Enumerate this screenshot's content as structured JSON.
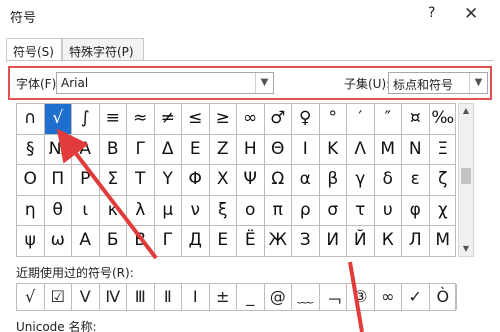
{
  "dialog": {
    "title": "符号",
    "help": "?",
    "close": "✕"
  },
  "tabs": [
    {
      "label": "符号(S)"
    },
    {
      "label": "特殊字符(P)"
    }
  ],
  "font": {
    "label": "字体(F):",
    "value": "Arial"
  },
  "subset": {
    "label": "子集(U):",
    "value": "标点和符号"
  },
  "symbols": [
    [
      "∩",
      "√",
      "∫",
      "≡",
      "≈",
      "≠",
      "≤",
      "≥",
      "∞",
      "♂",
      "♀",
      "°",
      "′",
      "″",
      "¤",
      "‰"
    ],
    [
      "§",
      "№",
      "Α",
      "Β",
      "Γ",
      "Δ",
      "Ε",
      "Ζ",
      "Η",
      "Θ",
      "Ι",
      "Κ",
      "Λ",
      "Μ",
      "Ν",
      "Ξ"
    ],
    [
      "Ο",
      "Π",
      "Ρ",
      "Σ",
      "Τ",
      "Υ",
      "Φ",
      "Χ",
      "Ψ",
      "Ω",
      "α",
      "β",
      "γ",
      "δ",
      "ε",
      "ζ"
    ],
    [
      "η",
      "θ",
      "ι",
      "κ",
      "λ",
      "μ",
      "ν",
      "ξ",
      "ο",
      "π",
      "ρ",
      "σ",
      "τ",
      "υ",
      "φ",
      "χ"
    ],
    [
      "ψ",
      "ω",
      "А",
      "Б",
      "В",
      "Г",
      "Д",
      "Е",
      "Ё",
      "Ж",
      "З",
      "И",
      "Й",
      "К",
      "Л",
      "М"
    ]
  ],
  "selected_symbol": "√",
  "recent_label": "近期使用过的符号(R):",
  "recent": [
    "√",
    "☑",
    "Ⅴ",
    "Ⅳ",
    "Ⅲ",
    "Ⅱ",
    "Ⅰ",
    "±",
    "_",
    "@",
    "﹏",
    "﹁",
    "③",
    "∞",
    "✓",
    "Ò"
  ],
  "unicode_label": "Unicode 名称:",
  "colors": {
    "highlight_border": "#e25252",
    "selection": "#1f6fcf",
    "annotation_arrow": "#e23b3b"
  }
}
